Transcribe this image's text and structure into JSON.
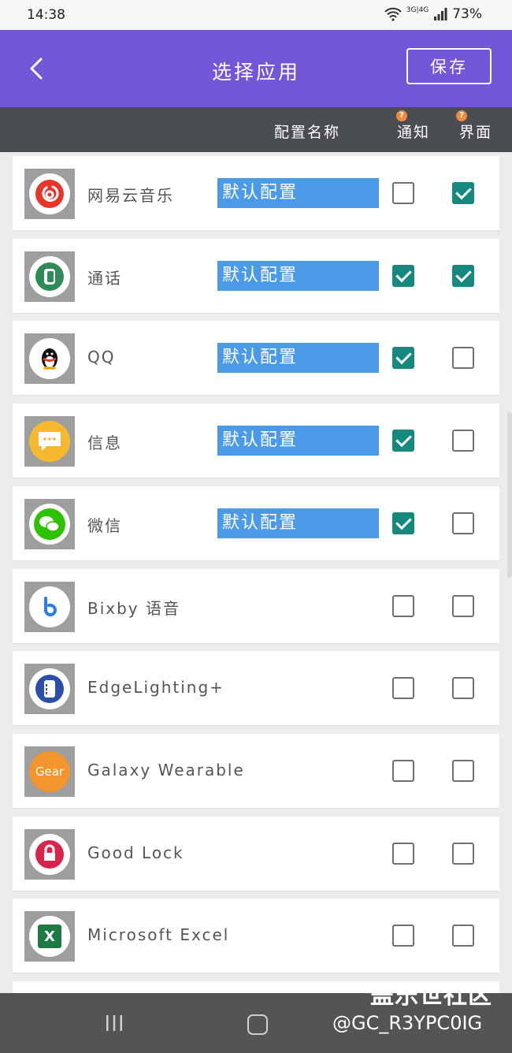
{
  "status_bar": {
    "time": "14:38",
    "network": "3G|4G",
    "battery": "73%"
  },
  "app_bar": {
    "title": "选择应用",
    "save_label": "保存"
  },
  "header": {
    "config_name": "配置名称",
    "notify": "通知",
    "ui": "界面",
    "help_mark": "?"
  },
  "apps": [
    {
      "name": "网易云音乐",
      "config": "默认配置",
      "notify": false,
      "ui": true,
      "icon": "netease-music-icon"
    },
    {
      "name": "通话",
      "config": "默认配置",
      "notify": true,
      "ui": true,
      "icon": "phone-icon"
    },
    {
      "name": "QQ",
      "config": "默认配置",
      "notify": true,
      "ui": false,
      "icon": "qq-penguin-icon"
    },
    {
      "name": "信息",
      "config": "默认配置",
      "notify": true,
      "ui": false,
      "icon": "messages-icon"
    },
    {
      "name": "微信",
      "config": "默认配置",
      "notify": true,
      "ui": false,
      "icon": "wechat-icon"
    },
    {
      "name": "Bixby 语音",
      "config": "",
      "notify": false,
      "ui": false,
      "icon": "bixby-icon"
    },
    {
      "name": "EdgeLighting+",
      "config": "",
      "notify": false,
      "ui": false,
      "icon": "edge-lighting-icon"
    },
    {
      "name": "Galaxy Wearable",
      "config": "",
      "notify": false,
      "ui": false,
      "icon": "gear-icon",
      "icon_text": "Gear"
    },
    {
      "name": "Good Lock",
      "config": "",
      "notify": false,
      "ui": false,
      "icon": "good-lock-icon"
    },
    {
      "name": "Microsoft Excel",
      "config": "",
      "notify": false,
      "ui": false,
      "icon": "excel-icon",
      "icon_text": "X"
    }
  ],
  "watermark": {
    "line1": "盖乐世社区",
    "line2": "@GC_R3YPC0IG"
  },
  "colors": {
    "app_bar": "#7257d9",
    "header_bar": "#4a4d52",
    "config_box": "#4b9ae8",
    "checked": "#15897d",
    "nav_bar": "#545454"
  }
}
